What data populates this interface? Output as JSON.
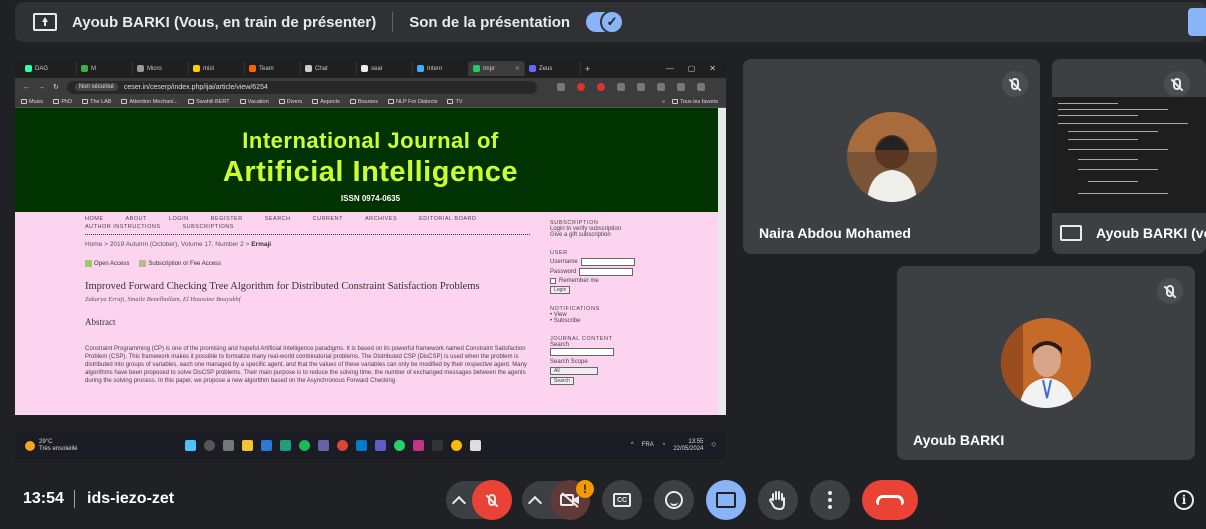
{
  "topbar": {
    "presenter_label": "Ayoub BARKI (Vous, en train de présenter)",
    "sound_label": "Son de la présentation",
    "sound_toggle_check": "✓"
  },
  "browser": {
    "tabs": [
      "DAG",
      "M",
      "Micro",
      "mist",
      "Team",
      "Chat",
      "sear",
      "Intern",
      "Impr",
      "Zeus"
    ],
    "tab_plus": "+",
    "window_controls": [
      "—",
      "▢",
      "✕"
    ],
    "nav_glyphs": [
      "←",
      "→",
      "↻"
    ],
    "not_secure_label": "Non sécurisé",
    "url": "ceser.in/ceserp/index.php/ijai/article/view/6254",
    "bookmarks": [
      "Music",
      "PhD",
      "The LAB",
      "Attention Mechani...",
      "Swahili BERT",
      "Vacation",
      "Divers",
      "Aspects",
      "Bourses",
      "NLP For Dialects",
      "TV"
    ],
    "bookmarks_more": "»",
    "all_bookmarks": "Tous les favoris"
  },
  "journal": {
    "title_line1": "International Journal of",
    "title_line2": "Artificial Intelligence",
    "issn": "ISSN 0974-0635",
    "nav": [
      "HOME",
      "ABOUT",
      "LOGIN",
      "REGISTER",
      "SEARCH",
      "CURRENT",
      "ARCHIVES",
      "EDITORIAL BOARD",
      "AUTHOR INSTRUCTIONS",
      "SUBSCRIPTIONS"
    ],
    "breadcrumb": "Home > 2019 Autumn (October), Volume 17, Number 2 >",
    "breadcrumb_current": "Ermaji",
    "open_access": "Open Access",
    "subscription_access": "Subscription or Fee Access",
    "article_title": "Improved Forward Checking Tree Algorithm for Distributed Constraint Satisfaction Problems",
    "authors": "Zakarya Erraji, Smaile Benelhallam, El Houssine Bouyakhf",
    "abstract_heading": "Abstract",
    "abstract_text": "Constraint Programming (CP) is one of the promising and hopeful Artificial Intelligence paradigms. It is based on its powerful framework named Constraint Satisfaction Problem (CSP). This framework makes it possible to formalize many real-world combinatorial problems. The Distributed CSP (DisCSP) is used when the problem is distributed into groups of variables, each one managed by a specific agent, and that the values of these variables can only be modified by their respective agent. Many algorithms have been proposed to solve DisCSP problems. Their main purpose is to reduce the solving time, the number of exchanged messages between the agents during the solving process. In this paper, we propose a new algorithm based on the Asynchronous Forward Checking",
    "sidebar": {
      "subscription_h": "SUBSCRIPTION",
      "subscription_l1": "Login to verify subscription",
      "subscription_l2": "Give a gift subscription",
      "user_h": "USER",
      "username": "Username",
      "password": "Password",
      "remember": "Remember me",
      "login_btn": "Login",
      "notifications_h": "NOTIFICATIONS",
      "notif_view": "View",
      "notif_subscribe": "Subscribe",
      "content_h": "JOURNAL CONTENT",
      "search": "Search",
      "search_scope": "Search Scope",
      "scope_value": "All",
      "search_btn": "Search"
    }
  },
  "taskbar": {
    "temp": "29°C",
    "weather": "Très ensoleillé",
    "lang": "FRA",
    "time": "13:55",
    "date": "22/05/2024"
  },
  "participants": [
    {
      "name": "Naira Abdou Mohamed"
    },
    {
      "name": "Ayoub BARKI (vo"
    },
    {
      "name": "Ayoub BARKI"
    }
  ],
  "bottom": {
    "clock": "13:54",
    "meeting_code": "ids-iezo-zet",
    "cam_badge": "!",
    "cc_label": "CC",
    "info_label": "i"
  },
  "colors": {
    "meet_bg": "#202124",
    "tile_bg": "#3c4043",
    "accent": "#8ab4f8",
    "hangup": "#ea4335",
    "journal_banner": "#003300",
    "journal_title": "#ccff33",
    "journal_page": "#fcd4ef"
  }
}
